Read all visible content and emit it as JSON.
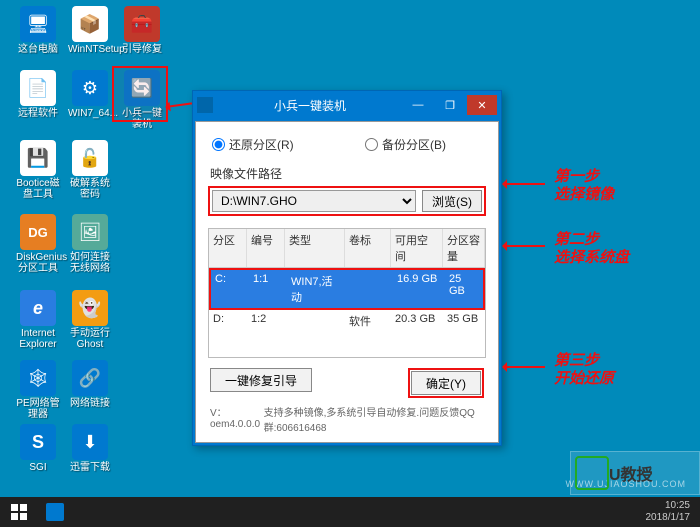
{
  "desktop": {
    "icons": [
      {
        "label": "这台电脑",
        "bg": "#0079cf",
        "glyph": "🖥"
      },
      {
        "label": "WinNTSetup",
        "bg": "#fff",
        "glyph": "📦"
      },
      {
        "label": "引导修复",
        "bg": "#c0392b",
        "glyph": "🧰"
      },
      {
        "label": "远程软件",
        "bg": "#fff",
        "glyph": "📄"
      },
      {
        "label": "WIN7_64...",
        "bg": "#0079cf",
        "glyph": "⚙"
      },
      {
        "label": "小兵一键装机",
        "bg": "#0079cf",
        "glyph": "🔄"
      },
      {
        "label": "Bootice磁盘工具",
        "bg": "#fff",
        "glyph": "💾"
      },
      {
        "label": "破解系统密码",
        "bg": "#fff",
        "glyph": "🔓"
      },
      {
        "label": "DiskGenius分区工具",
        "bg": "#e67e22",
        "glyph": "DG"
      },
      {
        "label": "如何连接无线网络",
        "bg": "#5a9",
        "glyph": "🖼"
      },
      {
        "label": "Internet Explorer",
        "bg": "#2a7de1",
        "glyph": "e"
      },
      {
        "label": "手动运行Ghost",
        "bg": "#f39c12",
        "glyph": "👻"
      },
      {
        "label": "PE网络管理器",
        "bg": "#0079cf",
        "glyph": "🕸"
      },
      {
        "label": "网络链接",
        "bg": "#0079cf",
        "glyph": "🔗"
      },
      {
        "label": "SGI",
        "bg": "#0079cf",
        "glyph": "S"
      },
      {
        "label": "迅雷下载",
        "bg": "#0079cf",
        "glyph": "⬇"
      }
    ]
  },
  "app": {
    "title": "小兵一键装机",
    "restore_label": "还原分区(R)",
    "backup_label": "备份分区(B)",
    "mirror_label": "映像文件路径",
    "path_value": "D:\\WIN7.GHO",
    "browse_label": "浏览(S)",
    "headers": {
      "drive": "分区",
      "num": "编号",
      "type": "类型",
      "vol": "卷标",
      "free": "可用空间",
      "total": "分区容量"
    },
    "rows": [
      {
        "drive": "C:",
        "num": "1:1",
        "type": "WIN7,活动",
        "vol": "",
        "free": "16.9 GB",
        "total": "25 GB"
      },
      {
        "drive": "D:",
        "num": "1:2",
        "type": "",
        "vol": "软件",
        "free": "20.3 GB",
        "total": "35 GB"
      }
    ],
    "repair_label": "一键修复引导",
    "ok_label": "确定(Y)",
    "version": "V：oem4.0.0.0",
    "tagline": "支持多种镜像,多系统引导自动修复.问题反馈QQ群:606616468"
  },
  "callouts": {
    "s1a": "第一步",
    "s1b": "选择镜像",
    "s2a": "第二步",
    "s2b": "选择系统盘",
    "s3a": "第三步",
    "s3b": "开始还原"
  },
  "taskbar": {
    "time": "10:25",
    "date": "2018/1/17"
  },
  "watermark": "WWW.UJIAOSHOU.COM",
  "ulogo": "U教授"
}
